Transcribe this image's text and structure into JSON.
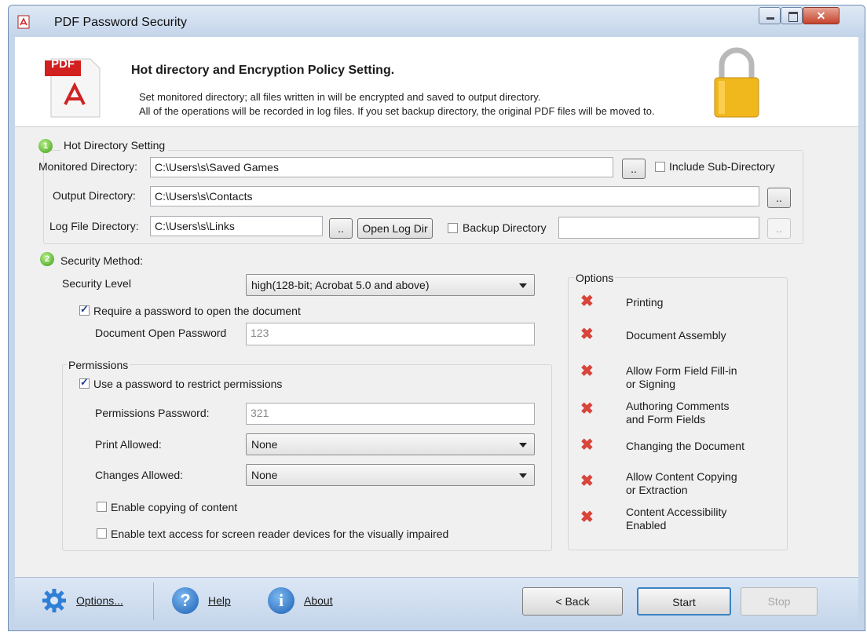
{
  "window": {
    "title": "PDF Password Security"
  },
  "header": {
    "title": "Hot directory and Encryption Policy Setting.",
    "line1": "Set monitored directory; all files written in will be encrypted and saved to output directory.",
    "line2": "All of the operations will be recorded in log files. If you set backup directory, the original PDF files will be moved to.",
    "logo_text": "PDF"
  },
  "hot_dir": {
    "section_number": "1",
    "title": "Hot Directory Setting",
    "monitored_label": "Monitored Directory:",
    "monitored_value": "C:\\Users\\s\\Saved Games",
    "include_sub_label": "Include Sub-Directory",
    "include_sub_checked": false,
    "output_label": "Output Directory:",
    "output_value": "C:\\Users\\s\\Contacts",
    "log_label": "Log File Directory:",
    "log_value": "C:\\Users\\s\\Links",
    "browse_label": "..",
    "open_log_label": "Open Log Dir",
    "backup_label": "Backup Directory",
    "backup_checked": false,
    "backup_value": ""
  },
  "security": {
    "section_number": "2",
    "title": "Security Method:",
    "level_label": "Security Level",
    "level_value": "high(128-bit; Acrobat 5.0 and above)",
    "require_open_label": "Require a password to open the document",
    "require_open_checked": true,
    "open_pw_label": "Document Open Password",
    "open_pw_value": "123",
    "permissions_title": "Permissions",
    "use_perm_label": "Use a password to restrict permissions",
    "use_perm_checked": true,
    "perm_pw_label": "Permissions Password:",
    "perm_pw_value": "321",
    "print_label": "Print Allowed:",
    "print_value": "None",
    "changes_label": "Changes Allowed:",
    "changes_value": "None",
    "copy_label": "Enable copying of content",
    "copy_checked": false,
    "text_access_label": "Enable text access for screen reader devices for the visually impaired",
    "text_access_checked": false
  },
  "options": {
    "title": "Options",
    "items": [
      {
        "label": "Printing"
      },
      {
        "label": "Document Assembly"
      },
      {
        "label": "Allow Form Field Fill-in\nor Signing"
      },
      {
        "label": "Authoring Comments\nand Form Fields"
      },
      {
        "label": "Changing the Document"
      },
      {
        "label": "Allow Content Copying\nor Extraction"
      },
      {
        "label": "Content Accessibility\nEnabled"
      }
    ]
  },
  "footer": {
    "options_label": "Options...",
    "help_label": "Help",
    "about_label": "About",
    "back_label": "< Back",
    "start_label": "Start",
    "stop_label": "Stop"
  },
  "colors": {
    "accent": "#3b82c4",
    "deny": "#d9443b",
    "footer_bg": "#c4d5ea"
  }
}
